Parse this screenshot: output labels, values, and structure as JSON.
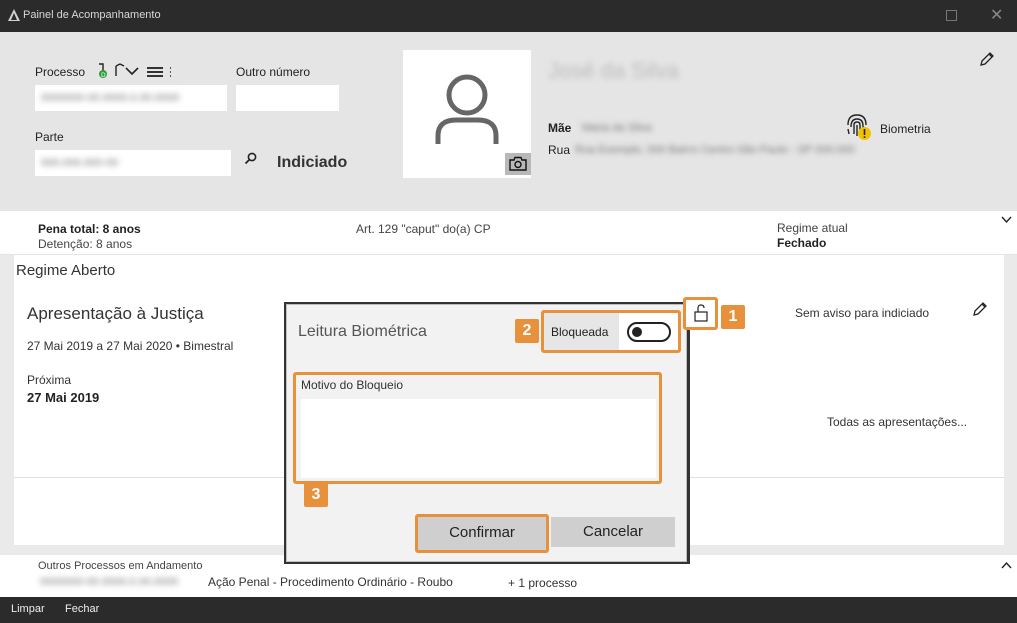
{
  "window": {
    "title": "Painel de Acompanhamento"
  },
  "header": {
    "processo_label": "Processo",
    "outro_numero_label": "Outro número",
    "parte_label": "Parte",
    "processo_value": "0000000-00.0000.0.00.0000",
    "parte_value": "000.000.000-00",
    "indiciado_label": "Indiciado",
    "person_name": "José da Silva",
    "mae_label": "Mãe",
    "mae_value": "Maria da Silva",
    "rua_label": "Rua",
    "rua_value": "Rua Exemplo, 000 Bairro Centro São Paulo - SP 000.000",
    "biometria_label": "Biometria"
  },
  "summary": {
    "pena_total": "Pena total: 8 anos",
    "detencao": "Detenção: 8 anos",
    "artigo": "Art. 129 \"caput\" do(a) CP",
    "regime_atual_label": "Regime atual",
    "regime_atual_value": "Fechado"
  },
  "main": {
    "regime_title": "Regime Aberto",
    "card_title": "Apresentação à Justiça",
    "card_period": "27 Mai 2019 a 27 Mai 2020 • Bimestral",
    "proxima_label": "Próxima",
    "proxima_value": "27 Mai 2019",
    "aviso_text": "Sem aviso para indiciado",
    "todas_link": "Todas as apresentações..."
  },
  "others": {
    "label": "Outros Processos em Andamento",
    "processo_blur": "0000000-00.0000.0.00.0000",
    "description": "Ação Penal - Procedimento Ordinário - Roubo",
    "more": "+ 1 processo"
  },
  "bottombar": {
    "limpar": "Limpar",
    "fechar": "Fechar"
  },
  "dialog": {
    "title": "Leitura Biométrica",
    "bloqueada_label": "Bloqueada",
    "motivo_label": "Motivo do Bloqueio",
    "motivo_value": "",
    "confirmar": "Confirmar",
    "cancelar": "Cancelar"
  },
  "callouts": [
    "1",
    "2",
    "3"
  ],
  "colors": {
    "accent": "#e8913c",
    "titlebar": "#2b2b2b",
    "header_bg": "#e5e5e5",
    "warning": "#f2c200",
    "green": "#2e9d3a"
  }
}
